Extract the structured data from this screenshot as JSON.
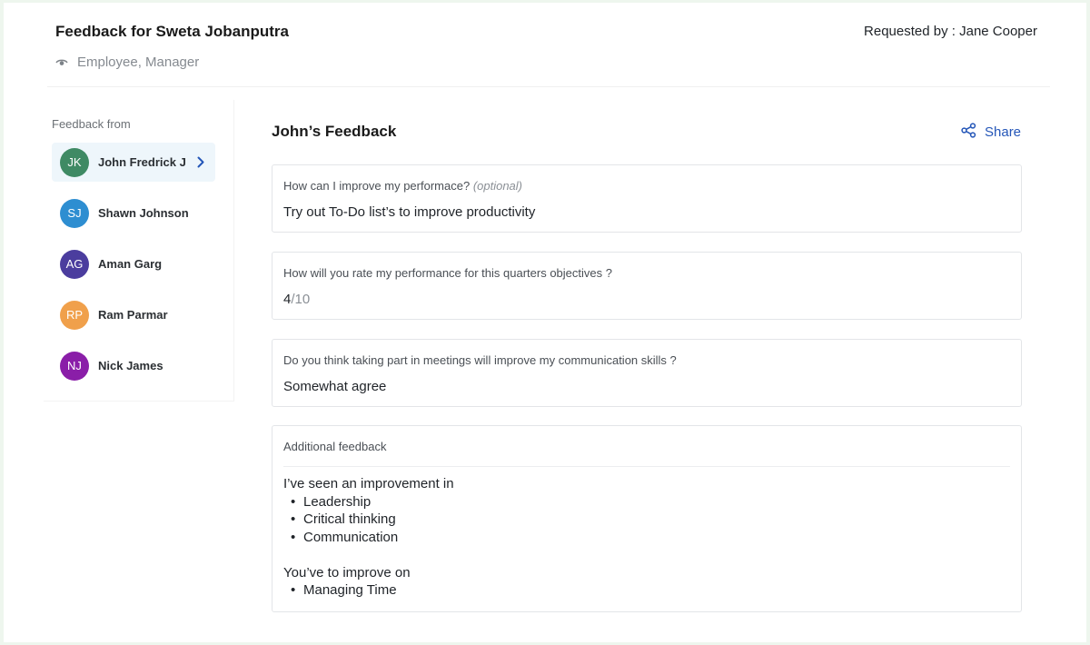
{
  "header": {
    "title": "Feedback for Sweta Jobanputra",
    "visibility": "Employee, Manager",
    "requested_by": "Requested by : Jane Cooper"
  },
  "sidebar": {
    "heading": "Feedback from",
    "people": [
      {
        "initials": "JK",
        "name": "John Fredrick J",
        "color": "#3f8a64",
        "active": true
      },
      {
        "initials": "SJ",
        "name": "Shawn Johnson",
        "color": "#2e8ed1",
        "active": false
      },
      {
        "initials": "AG",
        "name": "Aman Garg",
        "color": "#4b3d9e",
        "active": false
      },
      {
        "initials": "RP",
        "name": "Ram Parmar",
        "color": "#f0a04b",
        "active": false
      },
      {
        "initials": "NJ",
        "name": "Nick James",
        "color": "#8a1ea8",
        "active": false
      }
    ]
  },
  "main": {
    "title": "John’s Feedback",
    "share_label": "Share",
    "accent_color": "#2456b8",
    "questions": [
      {
        "label": "How can I improve my performace?",
        "optional": "(optional)",
        "answer": "Try out To-Do list’s to improve productivity"
      },
      {
        "label": "How will you rate my performance for this quarters objectives ?",
        "score": "4",
        "score_total": "/10"
      },
      {
        "label": "Do you think taking part in meetings will improve my communication skills ?",
        "answer": "Somewhat agree"
      }
    ],
    "additional": {
      "label": "Additional feedback",
      "intro1": "I’ve seen an improvement in",
      "list1": [
        "Leadership",
        "Critical thinking",
        "Communication"
      ],
      "intro2": "You’ve to improve on",
      "list2": [
        "Managing Time"
      ]
    }
  }
}
